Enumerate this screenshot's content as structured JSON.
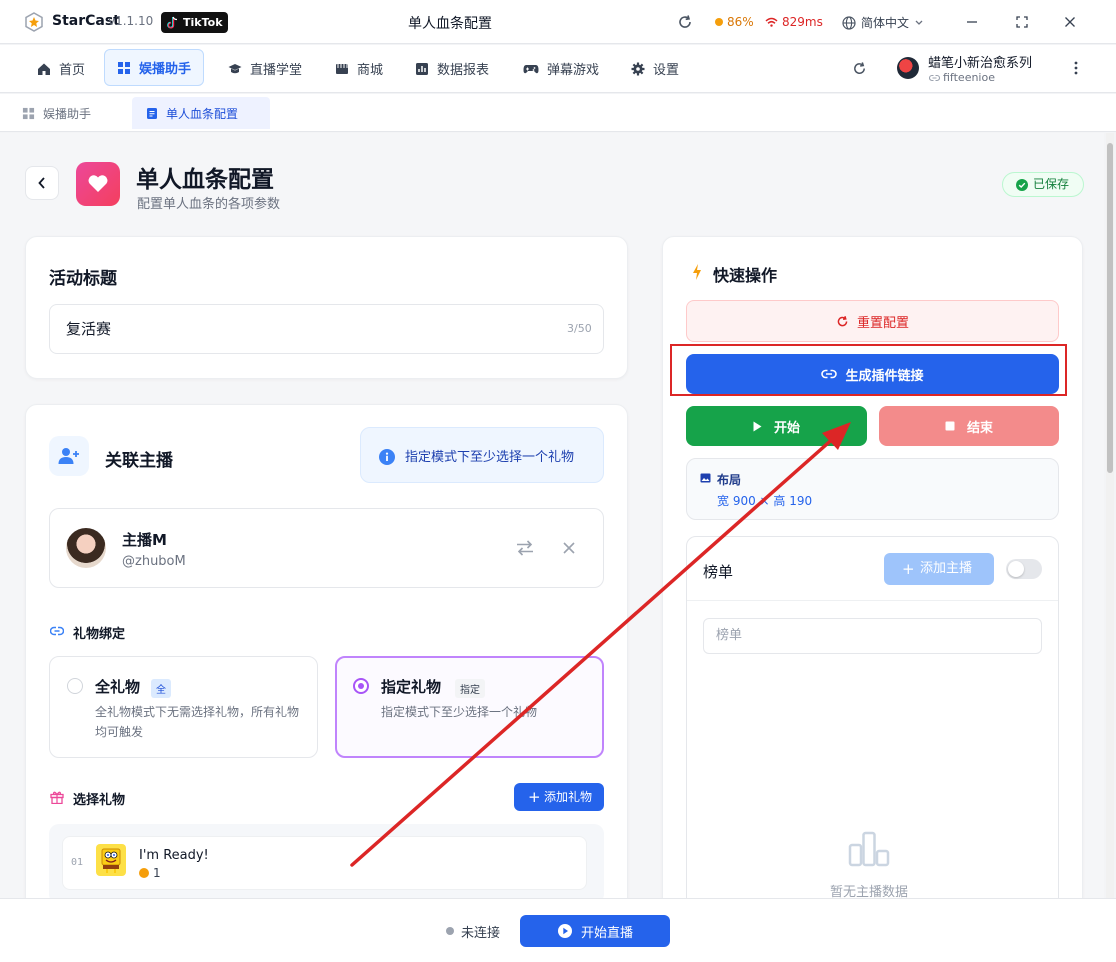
{
  "titlebar": {
    "app_name": "StarCast",
    "version": "v1.1.10",
    "platform": "TikTok",
    "window_title": "单人血条配置",
    "cpu": "86%",
    "ping": "829ms",
    "language": "简体中文"
  },
  "nav": {
    "items": [
      {
        "label": "首页",
        "icon": "home-icon"
      },
      {
        "label": "娱播助手",
        "icon": "grid-icon",
        "active": true
      },
      {
        "label": "直播学堂",
        "icon": "graduation-cap-icon"
      },
      {
        "label": "商城",
        "icon": "store-icon"
      },
      {
        "label": "数据报表",
        "icon": "chart-icon"
      },
      {
        "label": "弹幕游戏",
        "icon": "gamepad-icon"
      },
      {
        "label": "设置",
        "icon": "gear-icon"
      }
    ],
    "user_name": "蜡笔小新治愈系列",
    "user_id": "fifteenioe"
  },
  "tabs": [
    {
      "label": "娱播助手"
    },
    {
      "label": "单人血条配置",
      "active": true
    }
  ],
  "page": {
    "title": "单人血条配置",
    "subtitle": "配置单人血条的各项参数",
    "saved": "已保存"
  },
  "activity": {
    "title": "活动标题",
    "value": "复活赛",
    "count": "3/50"
  },
  "anchor": {
    "title": "关联主播",
    "hint": "指定模式下至少选择一个礼物",
    "name": "主播M",
    "handle": "@zhuboM"
  },
  "gift_binding": {
    "label": "礼物绑定",
    "options": [
      {
        "title": "全礼物",
        "tag": "全",
        "desc": "全礼物模式下无需选择礼物，所有礼物均可触发",
        "selected": false
      },
      {
        "title": "指定礼物",
        "tag": "指定",
        "desc": "指定模式下至少选择一个礼物",
        "selected": true
      }
    ]
  },
  "gift_select": {
    "label": "选择礼物",
    "add_label": "添加礼物",
    "items": [
      {
        "index": "01",
        "name": "I'm Ready!",
        "price": "1"
      }
    ]
  },
  "quick": {
    "title": "快速操作",
    "reset": "重置配置",
    "generate": "生成插件链接",
    "start": "开始",
    "stop": "结束",
    "layout_label": "布局",
    "layout_size": "宽 900 × 高 190"
  },
  "rank": {
    "title": "榜单",
    "add_anchor": "添加主播",
    "placeholder": "榜单",
    "empty": "暂无主播数据"
  },
  "footer": {
    "status": "未连接",
    "live": "开始直播"
  },
  "colors": {
    "primary": "#2563eb",
    "success": "#16a34a",
    "danger": "#dc2626",
    "purple": "#a855f7"
  }
}
